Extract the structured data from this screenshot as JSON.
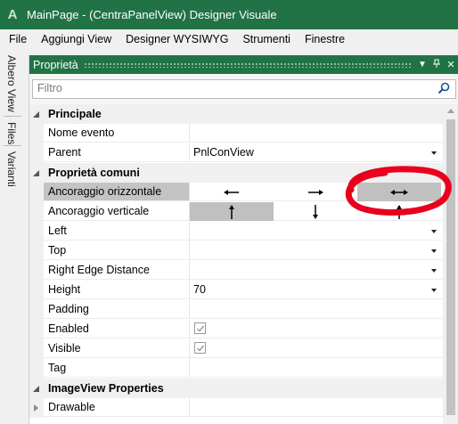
{
  "window": {
    "title": "MainPage - (CentraPanelView) Designer Visuale",
    "app_icon": "A"
  },
  "menu": [
    "File",
    "Aggiungi View",
    "Designer WYSIWYG",
    "Strumenti",
    "Finestre"
  ],
  "side_tabs": [
    "Albero View",
    "Files",
    "Varianti"
  ],
  "panel": {
    "title": "Proprietà",
    "search_placeholder": "Filtro"
  },
  "categories": {
    "principale": "Principale",
    "comuni": "Proprietà comuni",
    "imageview": "ImageView Properties"
  },
  "props": {
    "nome_evento": {
      "name": "Nome evento",
      "value": ""
    },
    "parent": {
      "name": "Parent",
      "value": "PnlConView"
    },
    "anc_orizz": {
      "name": "Ancoraggio orizzontale",
      "options": [
        "left",
        "right",
        "both"
      ],
      "selected": "both"
    },
    "anc_vert": {
      "name": "Ancoraggio verticale",
      "options": [
        "top",
        "bottom",
        "both"
      ],
      "selected": "top"
    },
    "left": {
      "name": "Left",
      "value": ""
    },
    "top": {
      "name": "Top",
      "value": ""
    },
    "right_edge": {
      "name": "Right Edge Distance",
      "value": ""
    },
    "height": {
      "name": "Height",
      "value": "70"
    },
    "padding": {
      "name": "Padding",
      "value": ""
    },
    "enabled": {
      "name": "Enabled",
      "checked": true
    },
    "visible": {
      "name": "Visible",
      "checked": true
    },
    "tag": {
      "name": "Tag",
      "value": ""
    },
    "drawable": {
      "name": "Drawable"
    }
  },
  "colors": {
    "accent": "#217346",
    "annotation": "#e8001c",
    "selected_row": "#c4c4c4"
  }
}
